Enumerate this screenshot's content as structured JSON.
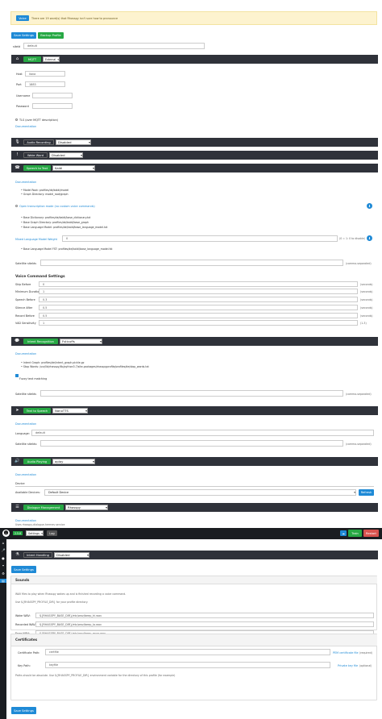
{
  "alert": {
    "button": "Voice",
    "text": "There are 19 word(s) that Rhasspy isn't sure how to pronounce"
  },
  "top_buttons": {
    "save": "Save Settings",
    "backup": "Backup Profile"
  },
  "siteid": {
    "label": "siteId",
    "value": "default"
  },
  "mqtt": {
    "title": "MQTT",
    "mode": "External",
    "host_label": "Host",
    "host": "liana",
    "port_label": "Port",
    "port": "1883",
    "user_label": "Username",
    "pass_label": "Password",
    "tls": "TLS (over MQTT description)",
    "doc": "Documentation"
  },
  "audio_recording": {
    "title": "Audio Recording",
    "value": "Disabled"
  },
  "wake_word": {
    "title": "Wake Word",
    "value": "Disabled"
  },
  "speech_to_text": {
    "title": "Speech to Text",
    "value": "Kaldi",
    "doc": "Documentation",
    "model_root": "Model Root: profiles/de/kaldi/model",
    "graph_dir": "Graph Directory: model_root/graph",
    "open_transcription": "Open transcription mode (no custom voice commands)",
    "base_dict": "Base Dictionary: profiles/de/kaldi/base_dictionary.txt",
    "base_graph": "Base Graph Directory: profiles/de/kaldi/base_graph",
    "base_lm": "Base Language Model: profiles/de/kaldi/base_language_model.txt",
    "mixed_label": "Mixed Language Model Weight",
    "mixed_value": "0",
    "mixed_hint": "(0 = 1: 0 to disable)",
    "base_fst": "Base Language Model FST: profiles/de/kaldi/base_language_model.fst",
    "satellite_label": "Satellite siteIds",
    "satellite_hint": "(comma-separated)"
  },
  "voice_command": {
    "title": "Voice Command Settings",
    "rows": [
      {
        "label": "Skip Before",
        "value": "0",
        "unit": "(seconds)"
      },
      {
        "label": "Minimum Duration",
        "value": "1",
        "unit": "(seconds)"
      },
      {
        "label": "Speech Before",
        "value": "0.3",
        "unit": "(seconds)"
      },
      {
        "label": "Silence After",
        "value": "0.5",
        "unit": "(seconds)"
      },
      {
        "label": "Record Before",
        "value": "0.5",
        "unit": "(seconds)"
      },
      {
        "label": "VAD Sensitivity",
        "value": "1",
        "unit": "(1-3)"
      }
    ]
  },
  "intent_recognition": {
    "title": "Intent Recognition",
    "value": "Fsticuffs",
    "doc": "Documentation",
    "intent_graph": "Intent Graph: profiles/de/intent_graph.pickle.gz",
    "stop_words": "Stop Words: /usr/lib/rhasspy/lib/python3.7/site-packages/rhasspyprofile/profiles/de/stop_words.txt",
    "fuzzy": "Fuzzy text matching",
    "satellite_label": "Satellite siteIds",
    "satellite_hint": "(comma-separated)"
  },
  "text_to_speech": {
    "title": "Text to Speech",
    "value": "NanoTTS",
    "doc": "Documentation",
    "lang_label": "Language:",
    "lang_value": "default",
    "satellite_label": "Satellite siteIds:",
    "satellite_hint": "(comma-separated)"
  },
  "audio_playing": {
    "title": "Audio Playing",
    "value": "aplay",
    "doc": "Documentation",
    "device_label": "Device",
    "available_label": "Available Devices:",
    "available_value": "Default Device",
    "refresh": "Refresh"
  },
  "dialogue": {
    "title": "Dialogue Management",
    "value": "Rhasspy",
    "doc": "Documentation",
    "doc2": "Uses rhasspy-dialogue-hermes service"
  },
  "navbar": {
    "version": "2.5.8",
    "settings": "Settings",
    "log": "Log",
    "train": "Train",
    "restart": "Restart"
  },
  "intent_handling": {
    "title": "Intent Handling",
    "value": "Disabled"
  },
  "save_label": "Save Settings",
  "sounds": {
    "title": "Sounds",
    "desc1": "WAV files to play when Rhasspy wakes up and is finished recording a voice command.",
    "desc2": "Use ${RHASSPY_PROFILE_DIR} for your profile directory.",
    "rows": [
      {
        "label": "Wake WAV:",
        "value": "${RHASSPY_BASE_DIR}/etc/wav/beep_hi.wav"
      },
      {
        "label": "Recorded WAV:",
        "value": "${RHASSPY_BASE_DIR}/etc/wav/beep_lo.wav"
      },
      {
        "label": "Error WAV:",
        "value": "${RHASSPY_BASE_DIR}/etc/wav/beep_error.wav"
      }
    ]
  },
  "certificates": {
    "title": "Certificates",
    "cert_label": "Certificate Path:",
    "cert_value": "certfile",
    "cert_hint": "PEM certificate file",
    "cert_req": "(required)",
    "key_label": "Key Path:",
    "key_value": "keyfile",
    "key_hint": "Private key file",
    "key_req": "(optional)",
    "note": "Paths should be absolute. Use ${RHASSPY_PROFILE_DIR} environment variable for the directory of this profile (for example)"
  }
}
